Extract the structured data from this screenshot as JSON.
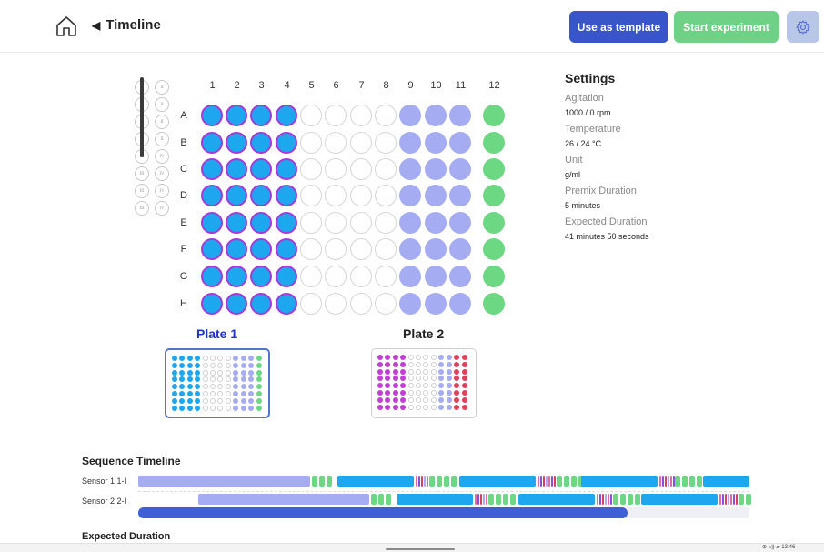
{
  "header": {
    "title": "Timeline",
    "back_glyph": "◀",
    "use_template_label": "Use as template",
    "start_experiment_label": "Start experiment",
    "icons": [
      "home-icon",
      "gear-icon"
    ]
  },
  "plate_grid": {
    "columns": [
      "1",
      "2",
      "3",
      "4",
      "5",
      "6",
      "7",
      "8",
      "9",
      "10",
      "11",
      "12"
    ],
    "rows": [
      "A",
      "B",
      "C",
      "D",
      "E",
      "F",
      "G",
      "H"
    ],
    "column_groups": [
      {
        "columns": "1-4",
        "fill": "blue",
        "color": "#1ca7ef",
        "outline": "#a43ad8"
      },
      {
        "columns": "5-8",
        "fill": "empty"
      },
      {
        "columns": "9-11",
        "fill": "lavender",
        "color": "#a6acf1"
      },
      {
        "columns": "12",
        "fill": "green",
        "color": "#6cd884"
      }
    ]
  },
  "selector": {
    "labels": [
      "I",
      "II",
      "I",
      "II",
      "I",
      "II",
      "I",
      "II",
      "III",
      "IV",
      "III",
      "IV",
      "III",
      "IV",
      "III",
      "IV"
    ]
  },
  "plates": [
    {
      "label": "Plate 1",
      "selected": true,
      "column_colors": [
        "#1ca7ef",
        "#1ca7ef",
        "#1ca7ef",
        "#1ca7ef",
        "empty",
        "empty",
        "empty",
        "empty",
        "#a6acf1",
        "#a6acf1",
        "#a6acf1",
        "#6cd884"
      ]
    },
    {
      "label": "Plate 2",
      "selected": false,
      "column_colors": [
        "#c13fd3",
        "#c13fd3",
        "#c13fd3",
        "#c13fd3",
        "empty",
        "empty",
        "empty",
        "empty",
        "#a6acf1",
        "#a6acf1",
        "#e0405a",
        "#e0405a"
      ]
    }
  ],
  "settings": {
    "title": "Settings",
    "items": [
      {
        "label": "Agitation",
        "value": "1000 / 0 rpm"
      },
      {
        "label": "Temperature",
        "value": "26 / 24 °C"
      },
      {
        "label": "Unit",
        "value": "g/ml"
      },
      {
        "label": "Premix Duration",
        "value": "5 minutes"
      },
      {
        "label": "Expected Duration",
        "value": "41 minutes  50 seconds"
      }
    ]
  },
  "sequence": {
    "title": "Sequence Timeline",
    "tracks": [
      {
        "label": "Sensor 1 1-I"
      },
      {
        "label": "Sensor 2 2-I"
      }
    ],
    "progress_fraction": 0.8,
    "colors": {
      "lavender": "#a6acf1",
      "green": "#6cd884",
      "blue": "#1ca7ef",
      "pink": "#e06aa8",
      "purple": "#8a4fd8",
      "red": "#d94059"
    }
  },
  "expected_duration_title": "Expected Duration",
  "system_bar": {
    "time": "13:46"
  }
}
